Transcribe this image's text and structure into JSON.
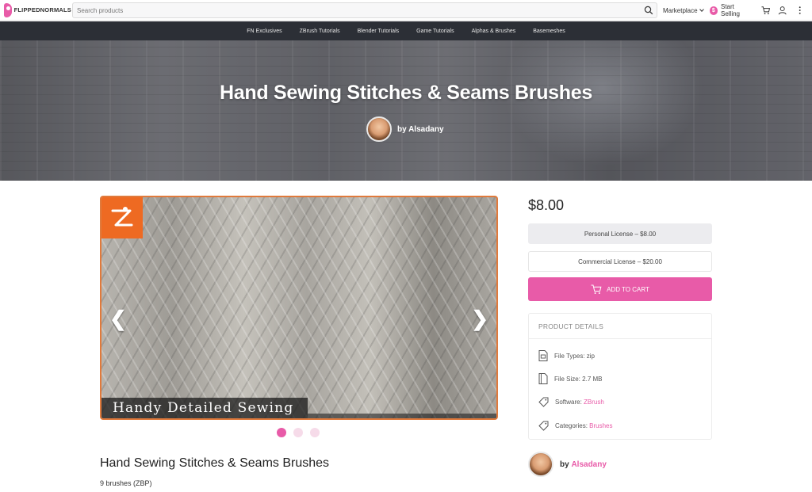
{
  "header": {
    "logo_text": "FLIPPEDNORMALS",
    "search_placeholder": "Search products",
    "marketplace_label": "Marketplace",
    "start_selling_label": "Start Selling",
    "dollar_symbol": "$"
  },
  "nav": {
    "items": [
      "FN Exclusives",
      "ZBrush Tutorials",
      "Blender Tutorials",
      "Game Tutorials",
      "Alphas & Brushes",
      "Basemeshes"
    ]
  },
  "hero": {
    "title": "Hand Sewing Stitches & Seams Brushes",
    "author": "by Alsadany"
  },
  "gallery": {
    "caption": "Handy Detailed Sewing",
    "prev_arrow": "❮",
    "next_arrow": "❯",
    "slide_count": 3,
    "active_slide": 1
  },
  "product": {
    "title": "Hand Sewing Stitches & Seams Brushes",
    "subtitle": "9 brushes (ZBP)",
    "price": "$8.00",
    "licenses": [
      {
        "label": "Personal License – $8.00",
        "selected": true
      },
      {
        "label": "Commercial License – $20.00",
        "selected": false
      }
    ],
    "cart_label": "ADD TO CART",
    "details_heading": "PRODUCT DETAILS",
    "details": {
      "file_types_label": "File Types:",
      "file_types_value": "zip",
      "file_size_label": "File Size:",
      "file_size_value": "2.7 MB",
      "software_label": "Software:",
      "software_value": "ZBrush",
      "categories_label": "Categories:",
      "categories_value": "Brushes"
    },
    "author_prefix": "by",
    "author_name": "Alsadany"
  },
  "colors": {
    "accent": "#e85ba8",
    "nav_bg": "#2c2f36",
    "badge": "#ee6a22"
  }
}
